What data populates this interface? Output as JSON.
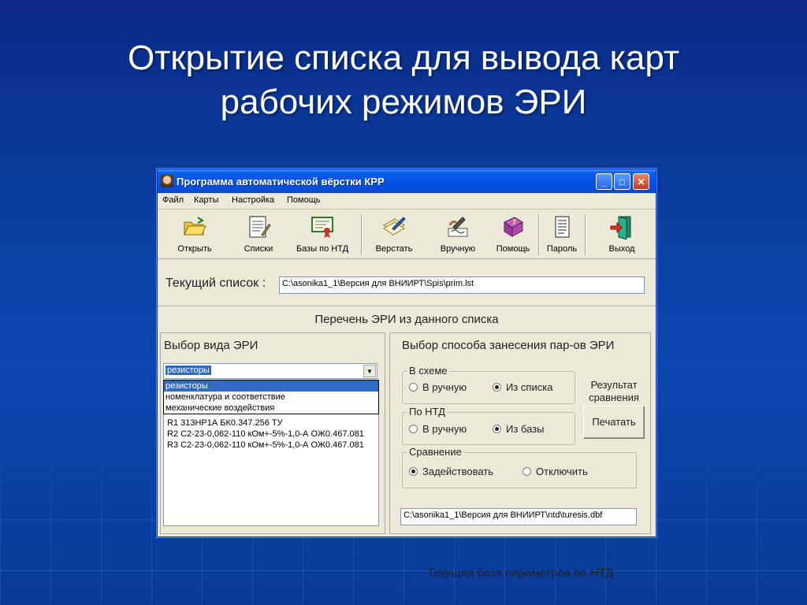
{
  "slide": {
    "title_line1": "Открытие списка для вывода карт",
    "title_line2": "рабочих режимов ЭРИ"
  },
  "window": {
    "title": "Программа автоматической вёрстки КРР",
    "minimize": "_",
    "maximize": "□",
    "close": "✕"
  },
  "menu": [
    "Файл",
    "Карты",
    "Настройка",
    "Помощь"
  ],
  "toolbar": [
    {
      "label": "Открыть",
      "icon": "folder-open-icon"
    },
    {
      "label": "Списки",
      "icon": "notepad-pencil-icon"
    },
    {
      "label": "Базы по НТД",
      "icon": "certificate-icon"
    },
    {
      "label": "Верстать",
      "icon": "documents-pen-icon"
    },
    {
      "label": "Вручную",
      "icon": "hand-writing-icon"
    },
    {
      "label": "Помощь",
      "icon": "help-book-icon"
    },
    {
      "label": "Пароль",
      "icon": "page-icon"
    },
    {
      "label": "Выход",
      "icon": "exit-door-icon"
    }
  ],
  "current_list": {
    "label": "Текущий список :",
    "value": "C:\\asonika1_1\\Версия для ВНИИРТ\\Spis\\prim.lst"
  },
  "section_title": "Перечень ЭРИ из данного списка",
  "left": {
    "heading": "Выбор вида ЭРИ",
    "combo_value": "резисторы",
    "dropdown": [
      "резисторы",
      "номенклатура и соответствие",
      "механические воздействия"
    ],
    "rows": [
      "R1   313НР1А БК0.347.256 ТУ",
      "R2   С2-23-0,062-110 кОм+-5%-1,0-А ОЖ0.467.081",
      "R3   С2-23-0,062-110 кОм+-5%-1,0-А ОЖ0.467.081"
    ]
  },
  "right": {
    "heading": "Выбор способа занесения пар-ов ЭРИ",
    "scheme": {
      "caption": "В схеме",
      "opt1": "В ручную",
      "opt2": "Из списка"
    },
    "ntd": {
      "caption": "По НТД",
      "opt1": "В ручную",
      "opt2": "Из базы"
    },
    "compare": {
      "caption": "Сравнение",
      "opt1": "Задействовать",
      "opt2": "Отключить"
    },
    "result_line1": "Результат",
    "result_line2": "сравнения",
    "print_button": "Печатать",
    "db_title": "Текущая база параметров по НТД",
    "db_value": "C:\\asonika1_1\\Версия для ВНИИРТ\\ntd\\turesis.dbf"
  }
}
